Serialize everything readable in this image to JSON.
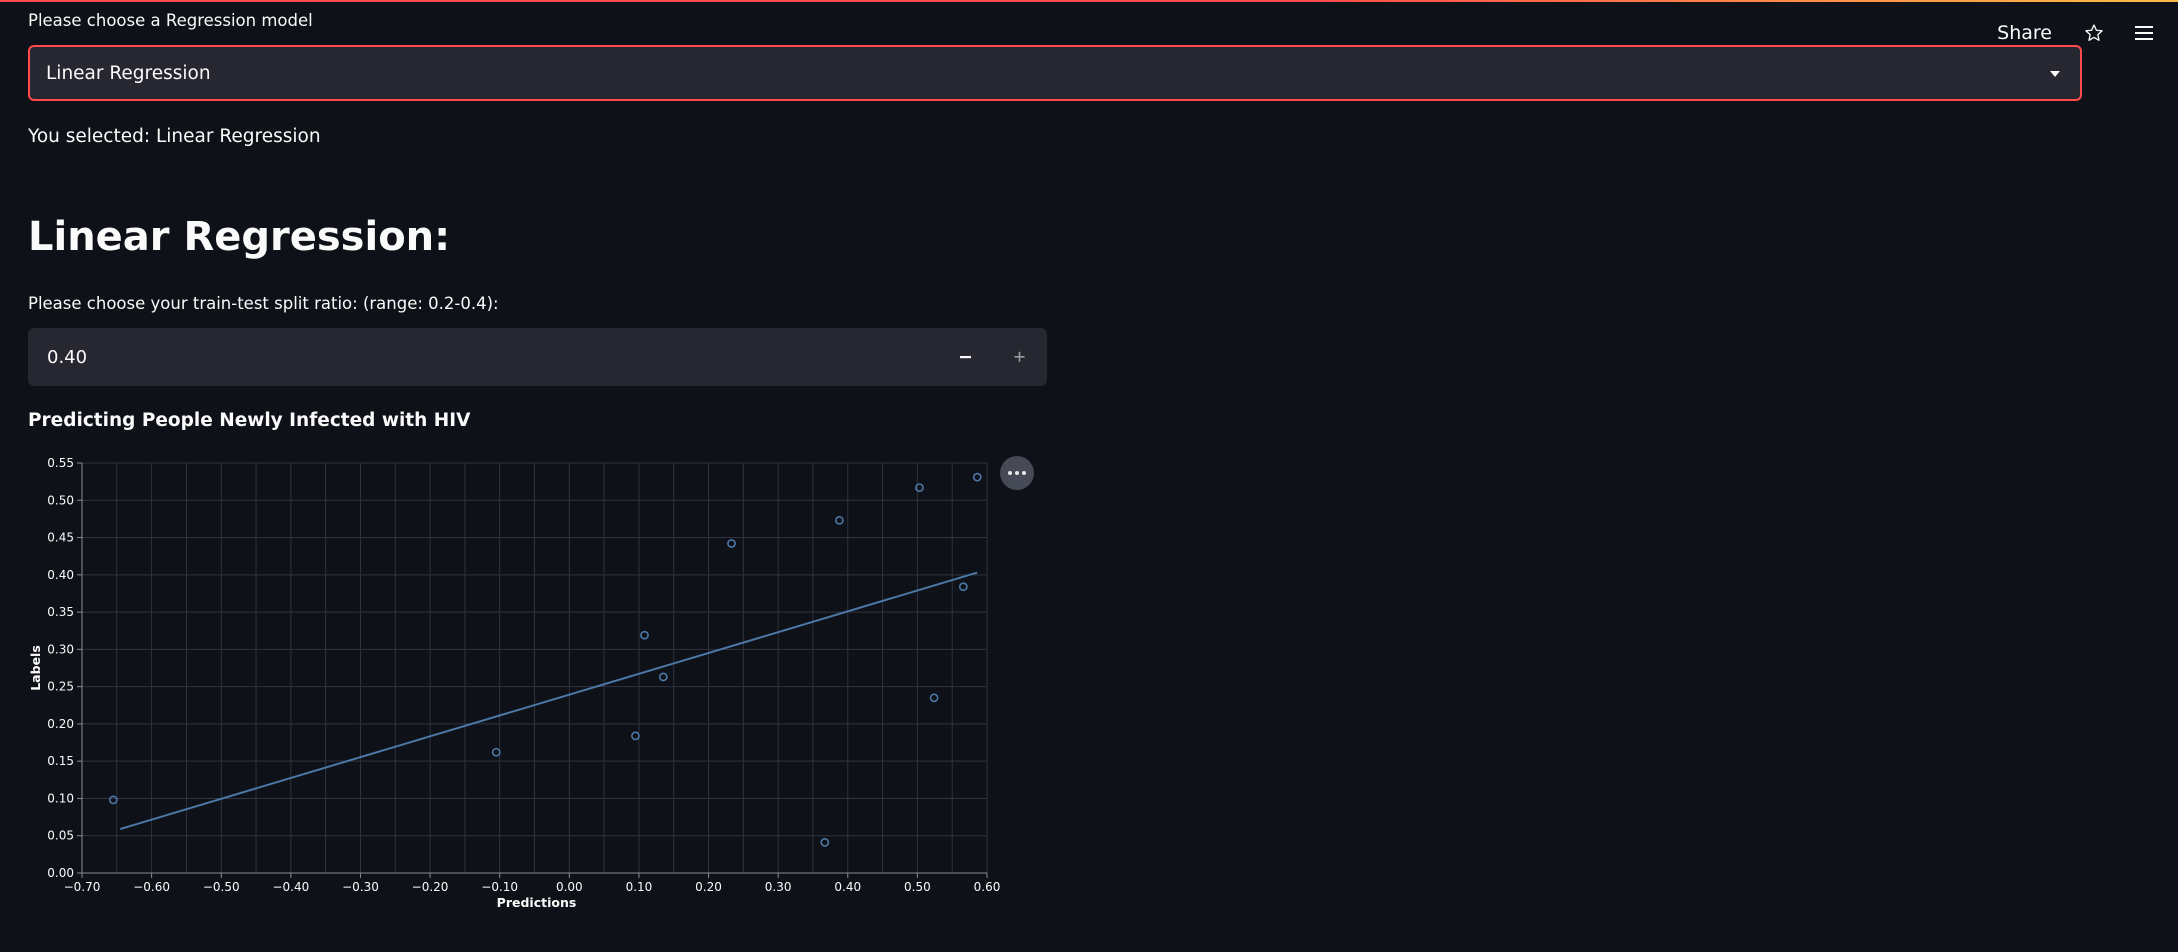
{
  "app": {
    "toolbar": {
      "share_label": "Share",
      "star_icon": "star-icon",
      "menu_icon": "hamburger-menu-icon"
    }
  },
  "model_select": {
    "label": "Please choose a Regression model",
    "value": "Linear Regression"
  },
  "selected_text": "You selected: Linear Regression",
  "section_heading": "Linear Regression:",
  "split_input": {
    "label": "Please choose your train-test split ratio: (range: 0.2-0.4):",
    "value": "0.40",
    "minus_label": "−",
    "plus_label": "+"
  },
  "chart_title": "Predicting People Newly Infected with HIV",
  "colors": {
    "accent": "#ff4b4b",
    "background": "#0e1117",
    "input_bg": "#262730",
    "series": "#4c78a8"
  },
  "chart_data": {
    "type": "scatter",
    "xlabel": "Predictions",
    "ylabel": "Labels",
    "xlim": [
      -0.7,
      0.6
    ],
    "ylim": [
      0,
      0.55
    ],
    "x_ticks": [
      "−0.70",
      "−0.60",
      "−0.50",
      "−0.40",
      "−0.30",
      "−0.20",
      "−0.10",
      "0.00",
      "0.10",
      "0.20",
      "0.30",
      "0.40",
      "0.50",
      "0.60"
    ],
    "x_tick_values": [
      -0.7,
      -0.6,
      -0.5,
      -0.4,
      -0.3,
      -0.2,
      -0.1,
      0,
      0.1,
      0.2,
      0.3,
      0.4,
      0.5,
      0.6
    ],
    "y_ticks": [
      "0.00",
      "0.05",
      "0.10",
      "0.15",
      "0.20",
      "0.25",
      "0.30",
      "0.35",
      "0.40",
      "0.45",
      "0.50",
      "0.55"
    ],
    "y_tick_values": [
      0,
      0.05,
      0.1,
      0.15,
      0.2,
      0.25,
      0.3,
      0.35,
      0.4,
      0.45,
      0.5,
      0.55
    ],
    "grid": true,
    "points": [
      {
        "x": -0.655,
        "y": 0.098
      },
      {
        "x": -0.105,
        "y": 0.162
      },
      {
        "x": 0.095,
        "y": 0.184
      },
      {
        "x": 0.108,
        "y": 0.319
      },
      {
        "x": 0.135,
        "y": 0.263
      },
      {
        "x": 0.233,
        "y": 0.442
      },
      {
        "x": 0.367,
        "y": 0.041
      },
      {
        "x": 0.388,
        "y": 0.473
      },
      {
        "x": 0.503,
        "y": 0.517
      },
      {
        "x": 0.524,
        "y": 0.235
      },
      {
        "x": 0.566,
        "y": 0.384
      },
      {
        "x": 0.586,
        "y": 0.531
      }
    ],
    "fit_line": {
      "x": [
        -0.645,
        0.586
      ],
      "y": [
        0.059,
        0.403
      ]
    }
  }
}
